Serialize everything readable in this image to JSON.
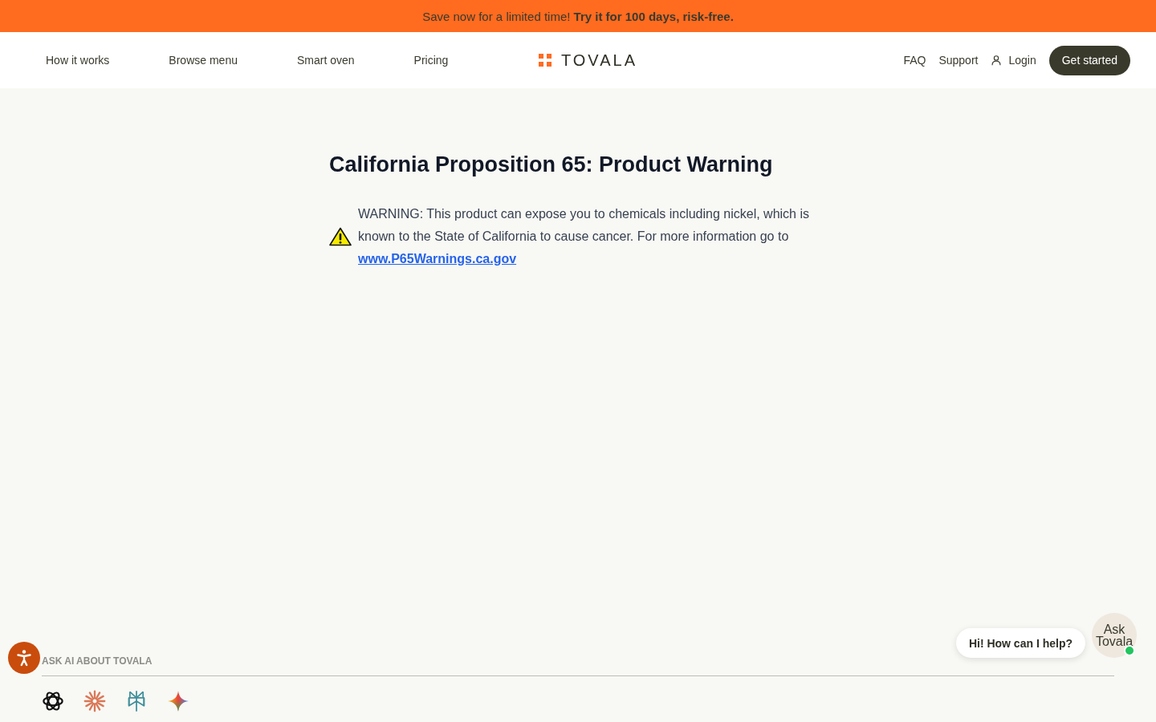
{
  "promo_banner": {
    "text": "Save now for a limited time! **Try it for 100 days, risk-free.**"
  },
  "nav": {
    "left_links": [
      "How it works",
      "Browse menu",
      "Smart oven",
      "Pricing"
    ],
    "logo": "TOVALA",
    "right_links": [
      "FAQ",
      "Support"
    ],
    "login": "Login",
    "cta": "Get started"
  },
  "warning": {
    "title": "California Proposition 65: Product Warning",
    "text": "WARNING: This product can expose you to chemicals including nickel, which is known to the State of California to cause cancer. For more information go to",
    "link": "www.P65Warnings.ca.gov"
  },
  "ask_ai": {
    "label": "ASK AI ABOUT TOVALA"
  },
  "chat_widget": {
    "greeting": "Hi! How can I help?",
    "button": "Ask Tovala",
    "online": true
  }
}
